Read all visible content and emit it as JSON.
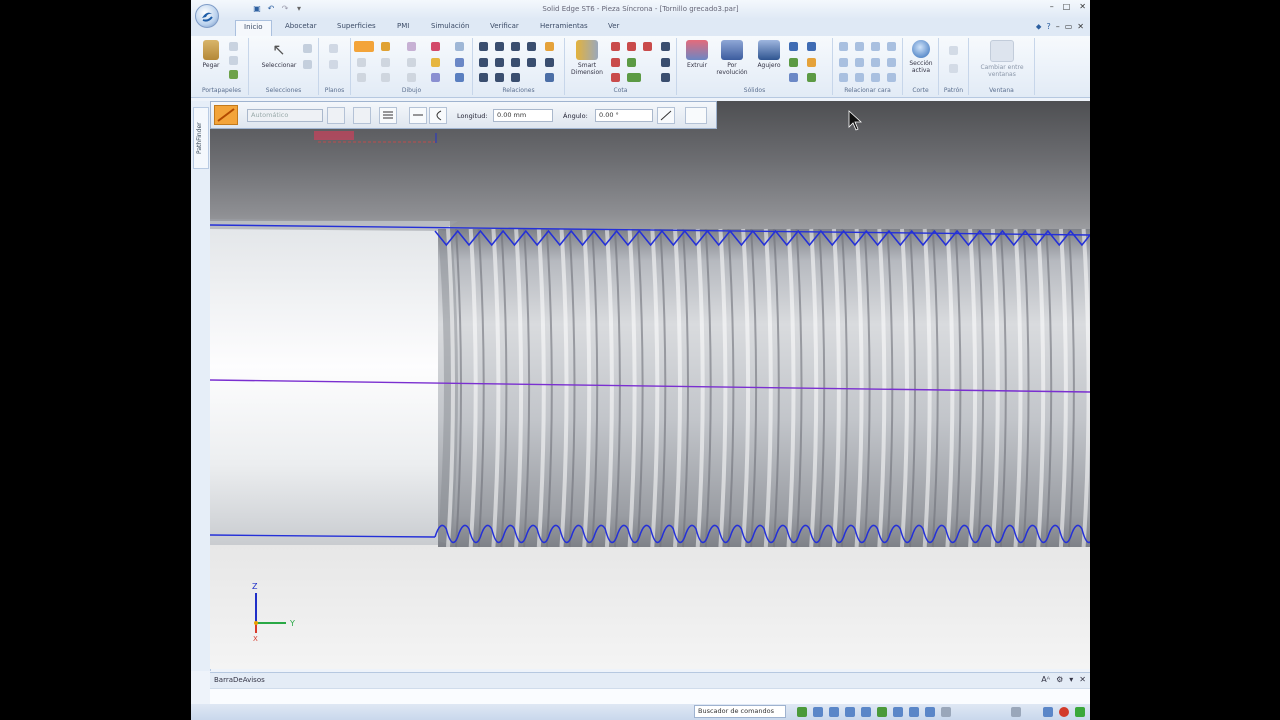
{
  "window": {
    "title": "Solid Edge ST6 - Pieza Síncrona - [Tornillo grecado3.par]",
    "controls": [
      "–",
      "□",
      "✕"
    ]
  },
  "quick_access": [
    "save-icon",
    "undo-icon",
    "redo-icon",
    "dropdown-icon"
  ],
  "tabs": [
    "Inicio",
    "Abocetar",
    "Superficies",
    "PMI",
    "Simulación",
    "Verificar",
    "Herramientas",
    "Ver"
  ],
  "active_tab": "Inicio",
  "ribbon": {
    "groups": [
      {
        "label": "Portapapeles",
        "buttons": [
          "Pegar"
        ]
      },
      {
        "label": "Selecciones",
        "buttons": [
          "Seleccionar"
        ]
      },
      {
        "label": "Planos",
        "buttons": []
      },
      {
        "label": "Dibujo",
        "buttons": []
      },
      {
        "label": "Relaciones",
        "buttons": []
      },
      {
        "label": "Cota",
        "buttons": [
          "Smart Dimension"
        ]
      },
      {
        "label": "Sólidos",
        "buttons": [
          "Extruir",
          "Por revolución",
          "Agujero"
        ]
      },
      {
        "label": "Relacionar cara",
        "buttons": []
      },
      {
        "label": "Corte",
        "buttons": [
          "Sección activa"
        ]
      },
      {
        "label": "Patrón",
        "buttons": []
      },
      {
        "label": "Ventana",
        "buttons": [
          "Cambiar entre ventanas"
        ]
      }
    ]
  },
  "command_bar": {
    "style_value": "Automático",
    "length_label": "Longitud:",
    "length_value": "0.00 mm",
    "angle_label": "Ángulo:",
    "angle_value": "0.00 °"
  },
  "left_panel": {
    "tab_label": "PathFinder"
  },
  "triad": {
    "z": "Z",
    "y": "Y",
    "x": "X"
  },
  "bottom_bar": {
    "label": "BarraDeAvisos"
  },
  "status_bar": {
    "command_finder": "Buscador de comandos"
  },
  "colors": {
    "thread_outline": "#2430d8",
    "axis_line": "#7a2fd0",
    "accent_orange": "#f3a43a",
    "ribbon_bg": "#e2ebf6"
  }
}
